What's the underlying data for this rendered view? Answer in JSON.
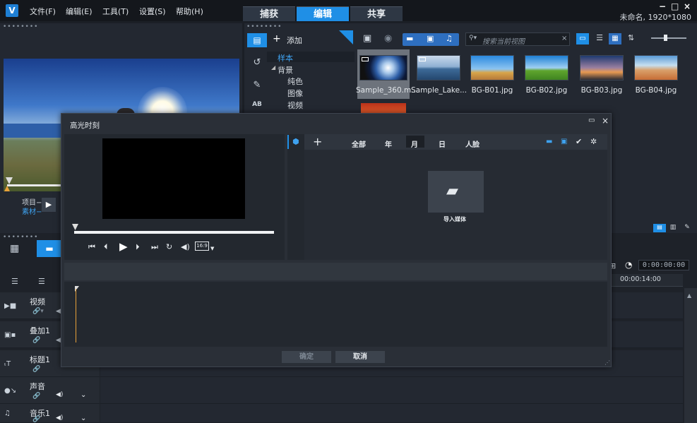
{
  "app": {
    "logo": "V",
    "project_name": "未命名, 1920*1080"
  },
  "menu": [
    "文件(F)",
    "编辑(E)",
    "工具(T)",
    "设置(S)",
    "帮助(H)"
  ],
  "tabs": [
    "捕获",
    "编辑",
    "共享"
  ],
  "window_controls": {
    "minimize": "−",
    "maximize": "□",
    "close": "×"
  },
  "player": {
    "project_label": "项目−",
    "clip_label": "素材−"
  },
  "library": {
    "add_label": "添加",
    "tree": {
      "samples": "样本",
      "background": "背景",
      "solid": "纯色",
      "image": "图像",
      "video": "视频"
    },
    "search_placeholder": "搜索当前视图",
    "items": [
      "Sample_360.m...",
      "Sample_Lake...",
      "BG-B01.jpg",
      "BG-B02.jpg",
      "BG-B03.jpg",
      "BG-B04.jpg"
    ]
  },
  "dialog": {
    "title": "高光时刻",
    "filters": [
      "全部",
      "年",
      "月",
      "日",
      "人脸"
    ],
    "import_label": "导入媒体",
    "ok_label": "确定",
    "cancel_label": "取消",
    "aspect": "16:9"
  },
  "timeline": {
    "timecode": "0:00:00:00",
    "ruler_time": "00:00:14:00",
    "tracks": [
      {
        "name": "视频",
        "icon": "video-track-icon"
      },
      {
        "name": "叠加1",
        "icon": "overlay-track-icon"
      },
      {
        "name": "标题1",
        "icon": "title-track-icon"
      },
      {
        "name": "声音",
        "icon": "voice-track-icon"
      },
      {
        "name": "音乐1",
        "icon": "music-track-icon"
      }
    ]
  },
  "colors": {
    "accent": "#1f8fe6",
    "dialog_bg": "#2a2f37",
    "panel_bg": "#232831"
  }
}
